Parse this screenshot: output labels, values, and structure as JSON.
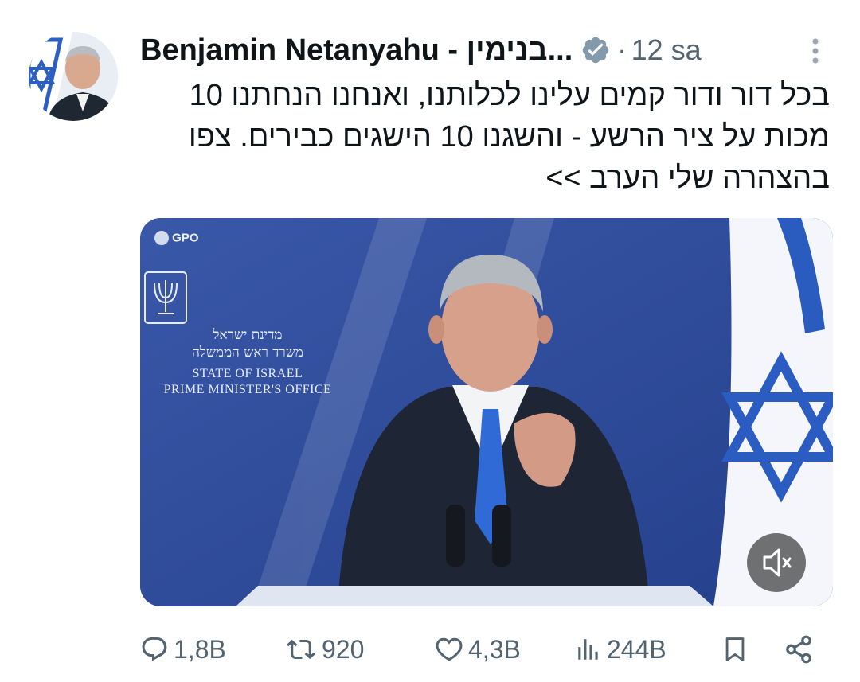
{
  "author": {
    "display_name": "Benjamin Netanyahu - בנימין...",
    "verified_icon": "verified-badge-icon",
    "separator": "·",
    "time_ago": "12 sa"
  },
  "tweet": {
    "text": "בכל דור ודור קמים עלינו לכלותנו, ואנחנו הנחתנו 10 מכות על ציר הרשע - והשגנו 10 הישגים כבירים. צפו בהצהרה שלי הערב >>"
  },
  "media": {
    "watermark": "GPO",
    "office_hebrew_line1": "מדינת ישראל",
    "office_hebrew_line2": "משרד ראש הממשלה",
    "office_english_line1": "STATE OF ISRAEL",
    "office_english_line2": "PRIME MINISTER'S OFFICE",
    "emblem_icon": "menorah-emblem-icon",
    "mute_icon": "speaker-muted-icon"
  },
  "actions": {
    "replies": "1,8B",
    "reposts": "920",
    "likes": "4,3B",
    "views": "244B"
  },
  "colors": {
    "text": "#0f1419",
    "secondary": "#536471",
    "verified": "#829aab",
    "backdrop_blue": "#2e4a9a",
    "flag_blue": "#1f4fa8"
  }
}
